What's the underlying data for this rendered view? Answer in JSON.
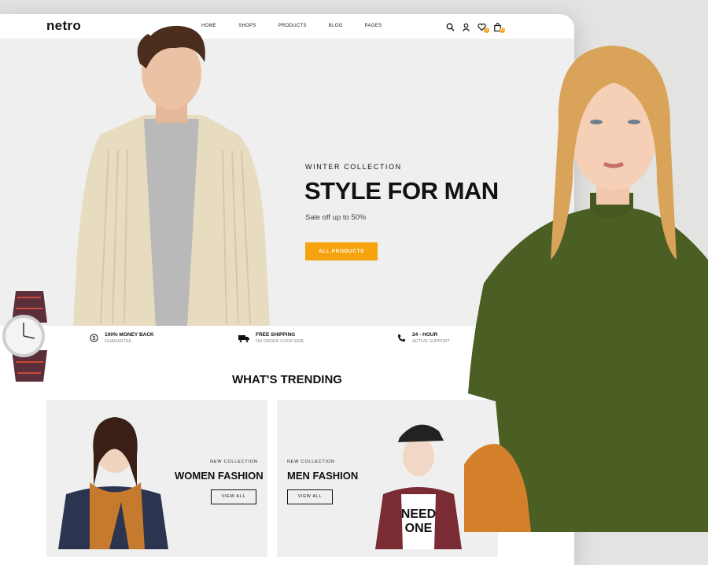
{
  "header": {
    "logo": "netro",
    "nav": [
      "HOME",
      "SHOPS",
      "PRODUCTS",
      "BLOG",
      "PAGES"
    ],
    "wishlist_count": "0",
    "cart_count": "0"
  },
  "hero": {
    "eyebrow": "WINTER COLLECTION",
    "title": "STYLE FOR MAN",
    "subtitle": "Sale off up to 50%",
    "button_label": "ALL PRODUCTS"
  },
  "features": [
    {
      "title": "100% MONEY BACK",
      "subtitle": "GUARANTEE",
      "icon": "dollar-icon"
    },
    {
      "title": "FREE SHIPPING",
      "subtitle": "ON ORDER OVER 500$",
      "icon": "truck-icon"
    },
    {
      "title": "24 - HOUR",
      "subtitle": "ACTIVE SUPPORT",
      "icon": "phone-icon"
    }
  ],
  "trending": {
    "title": "WHAT'S TRENDING",
    "cards": [
      {
        "eyebrow": "NEW COLLECTION",
        "name": "WOMEN FASHION",
        "button": "VIEW ALL"
      },
      {
        "eyebrow": "NEW COLLECTION",
        "name": "MEN FASHION",
        "button": "VIEW ALL",
        "shirt_text": "NEED ONE"
      }
    ]
  },
  "colors": {
    "accent": "#f7a20f",
    "background": "#efefef",
    "text": "#111111"
  }
}
